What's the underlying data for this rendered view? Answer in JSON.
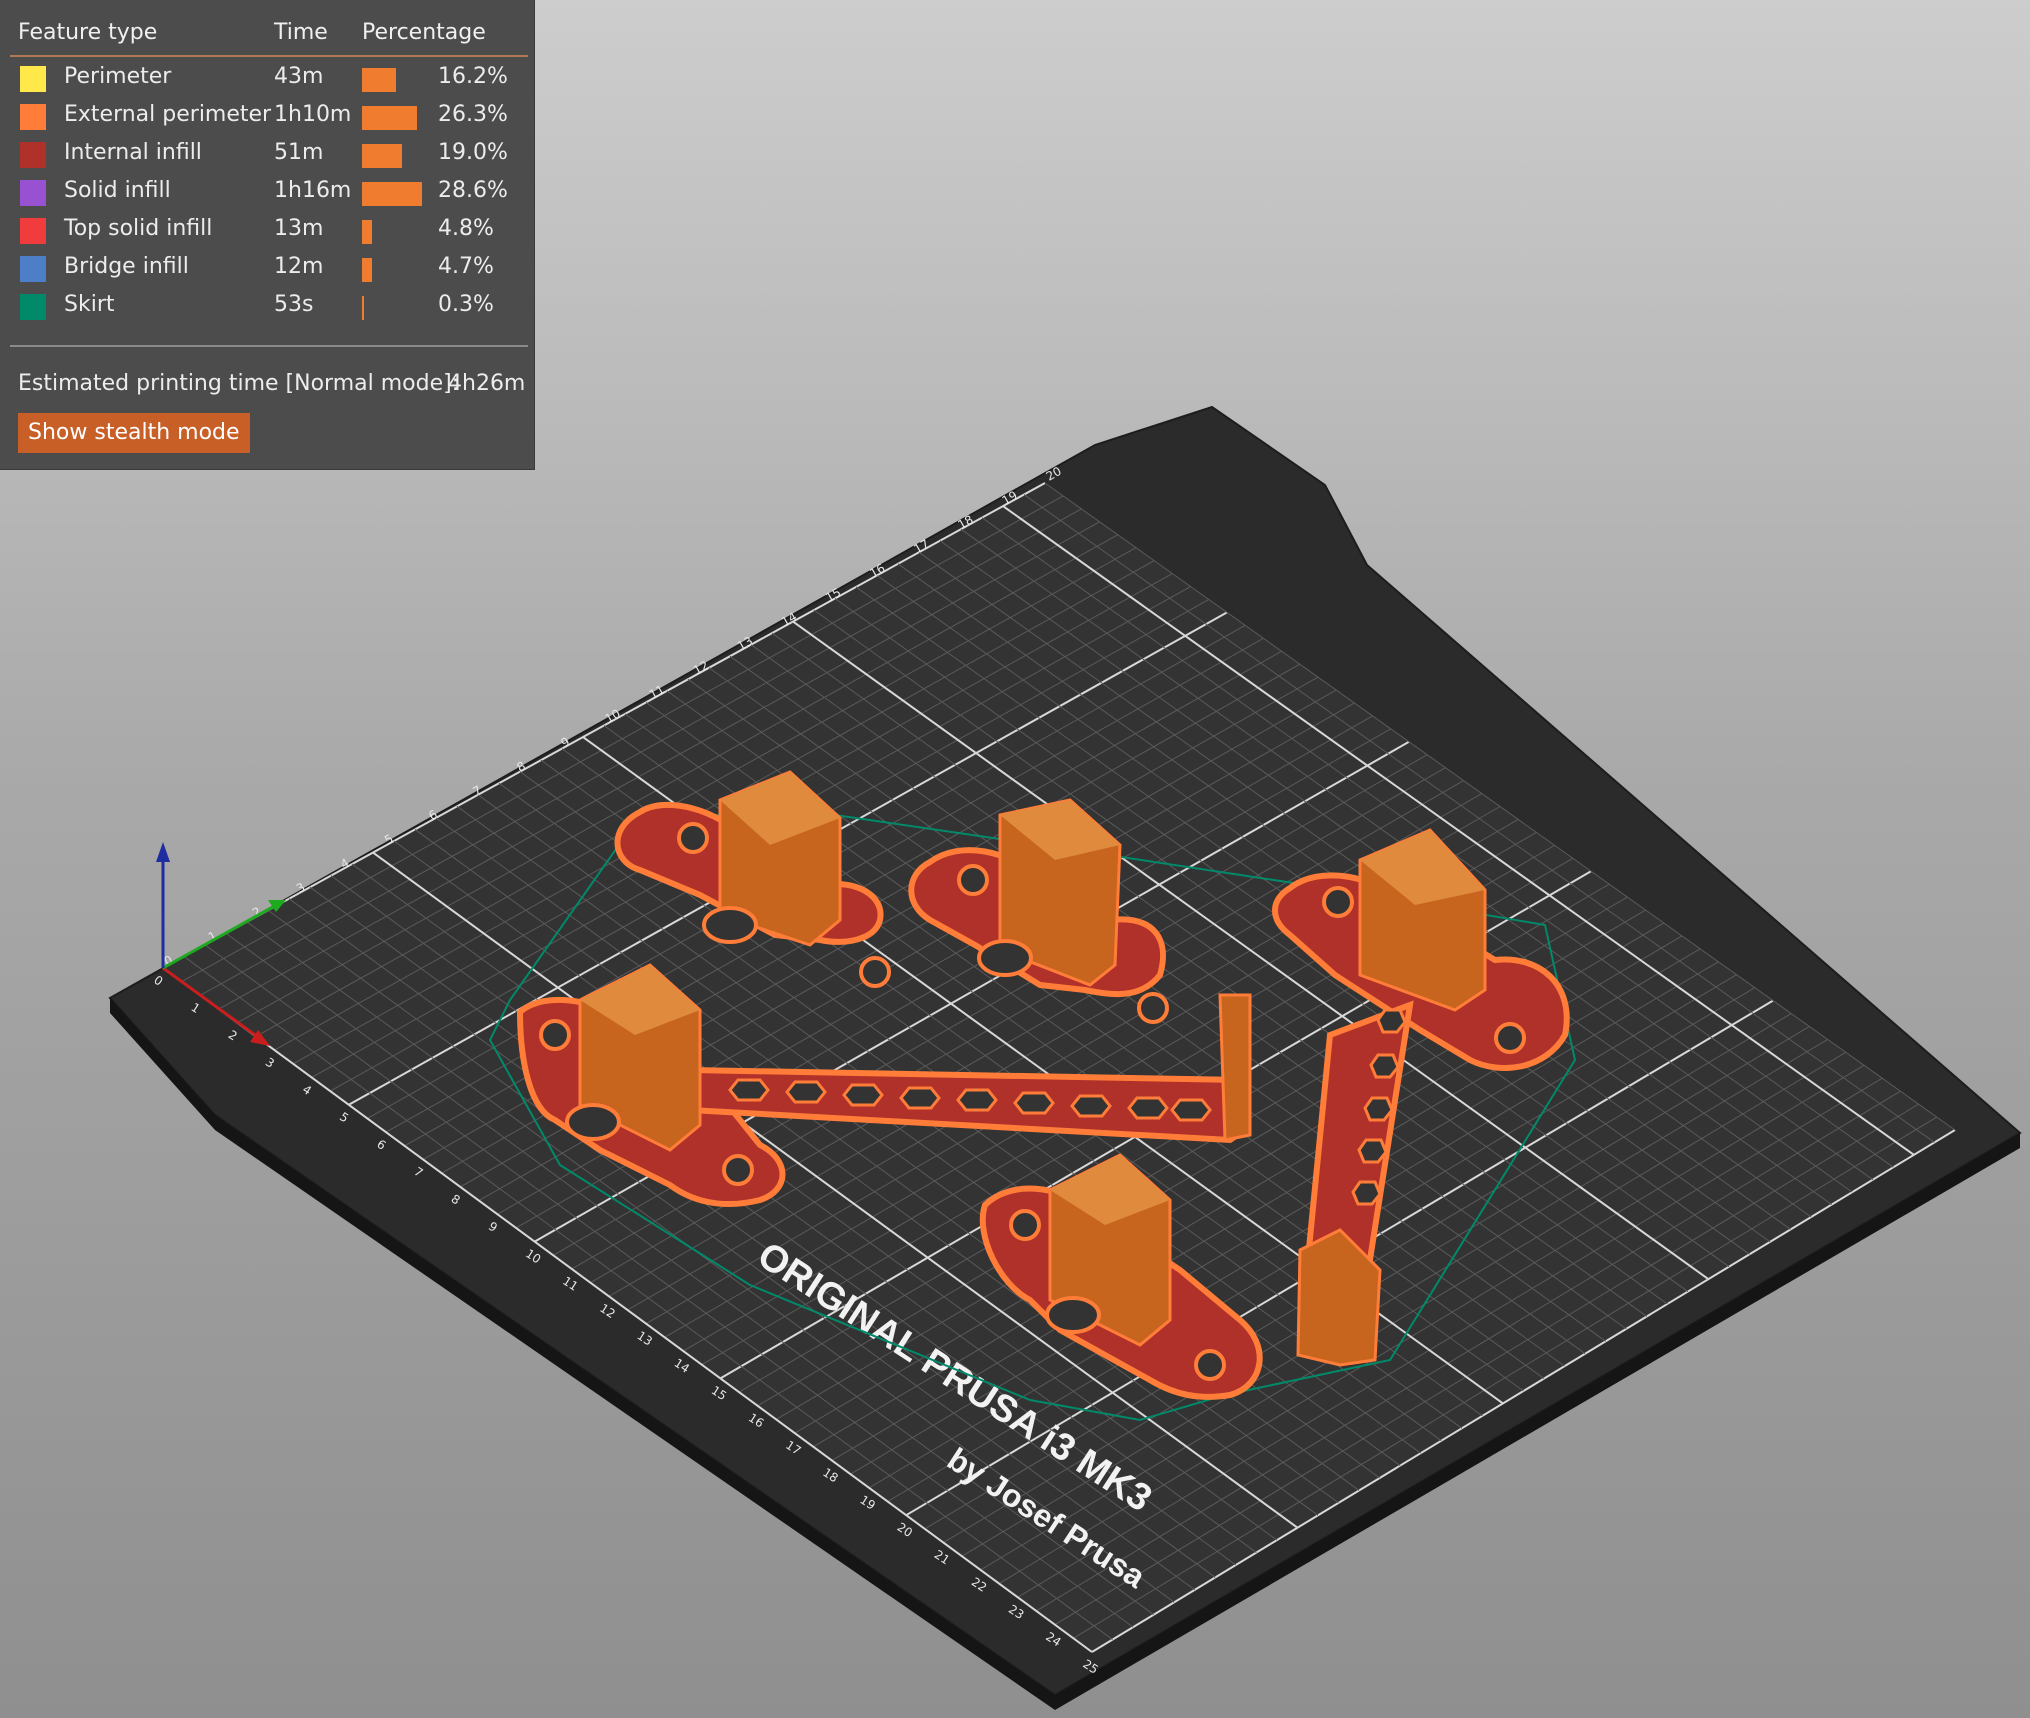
{
  "legend": {
    "headers": {
      "feature": "Feature type",
      "time": "Time",
      "percentage": "Percentage"
    },
    "items": [
      {
        "name": "Perimeter",
        "time": "43m",
        "percentage": "16.2%",
        "fraction": 0.162,
        "color": "#ffe84a"
      },
      {
        "name": "External perimeter",
        "time": "1h10m",
        "percentage": "26.3%",
        "fraction": 0.263,
        "color": "#ff7d38"
      },
      {
        "name": "Internal infill",
        "time": "51m",
        "percentage": "19.0%",
        "fraction": 0.19,
        "color": "#b0302a"
      },
      {
        "name": "Solid infill",
        "time": "1h16m",
        "percentage": "28.6%",
        "fraction": 0.286,
        "color": "#9851d0"
      },
      {
        "name": "Top solid infill",
        "time": "13m",
        "percentage": "4.8%",
        "fraction": 0.048,
        "color": "#f03c3c"
      },
      {
        "name": "Bridge infill",
        "time": "12m",
        "percentage": "4.7%",
        "fraction": 0.047,
        "color": "#4d7fc8"
      },
      {
        "name": "Skirt",
        "time": "53s",
        "percentage": "0.3%",
        "fraction": 0.003,
        "color": "#008a6a"
      }
    ],
    "estimate_label": "Estimated printing time [Normal mode]:",
    "estimate_value": "4h26m",
    "stealth_button": "Show stealth mode"
  },
  "bed": {
    "brand_line1": "ORIGINAL PRUSA i3 MK3",
    "brand_line2": "by Josef Prusa",
    "x_ticks": [
      "0",
      "1",
      "2",
      "3",
      "4",
      "5",
      "6",
      "7",
      "8",
      "9",
      "10",
      "11",
      "12",
      "13",
      "14",
      "15",
      "16",
      "17",
      "18",
      "19",
      "20",
      "21",
      "22",
      "23",
      "24",
      "25"
    ],
    "y_ticks": [
      "0",
      "1",
      "2",
      "3",
      "4",
      "5",
      "6",
      "7",
      "8",
      "9",
      "10",
      "11",
      "12",
      "13",
      "14",
      "15",
      "16",
      "17",
      "18",
      "19",
      "20"
    ]
  },
  "colors": {
    "infill": "#b0302a",
    "perimeter": "#ff7d38",
    "skirt": "#008a6a",
    "bed": "#2c2c2c",
    "axis_x": "#c81e1e",
    "axis_y": "#1eaa1e",
    "axis_z": "#1e2ea0"
  }
}
